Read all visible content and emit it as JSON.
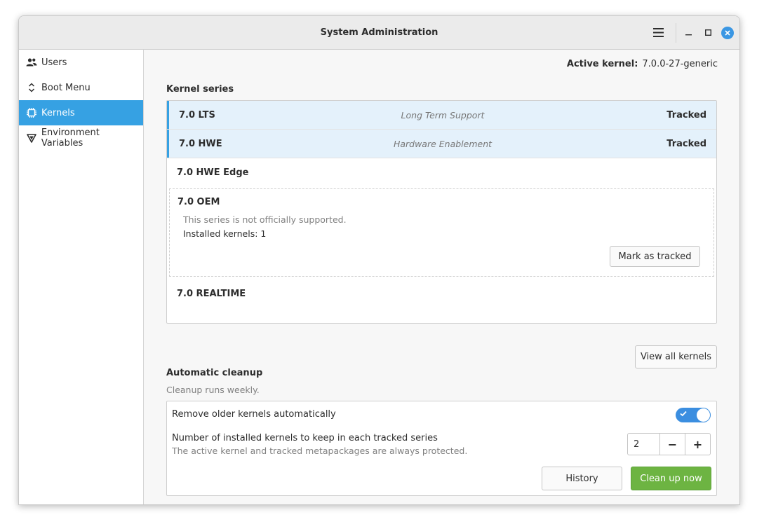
{
  "window": {
    "title": "System Administration"
  },
  "sidebar": {
    "items": [
      {
        "label": "Users",
        "icon": "users-icon"
      },
      {
        "label": "Boot Menu",
        "icon": "boot-menu-icon"
      },
      {
        "label": "Kernels",
        "icon": "chip-icon",
        "active": true
      },
      {
        "label": "Environment Variables",
        "icon": "variables-icon"
      }
    ]
  },
  "header": {
    "active_kernel_label": "Active kernel:",
    "active_kernel_value": "7.0.0-27-generic"
  },
  "kernel_series": {
    "heading": "Kernel series",
    "rows": [
      {
        "name": "7.0 LTS",
        "description": "Long Term Support",
        "state": "Tracked"
      },
      {
        "name": "7.0 HWE",
        "description": "Hardware Enablement",
        "state": "Tracked"
      },
      {
        "name": "7.0 HWE Edge",
        "description": "",
        "state": ""
      },
      {
        "name": "7.0 OEM",
        "note": "This series is not officially supported.",
        "installed": "Installed kernels: 1",
        "action": "Mark as tracked"
      },
      {
        "name": "7.0 REALTIME",
        "description": "",
        "state": ""
      }
    ],
    "view_all_label": "View all kernels"
  },
  "cleanup": {
    "heading": "Automatic cleanup",
    "subtext": "Cleanup runs weekly.",
    "auto_remove_label": "Remove older kernels automatically",
    "auto_remove_enabled": true,
    "keep_label": "Number of installed kernels to keep in each tracked series",
    "keep_sub": "The active kernel and tracked metapackages are always protected.",
    "keep_value": "2",
    "decrement": "−",
    "increment": "+",
    "history_label": "History",
    "clean_label": "Clean up now"
  },
  "colors": {
    "accent": "#36a1e3",
    "tracked_bg": "#e4f1fb",
    "primary_button": "#6db442",
    "toggle_on": "#3b8ee0"
  }
}
